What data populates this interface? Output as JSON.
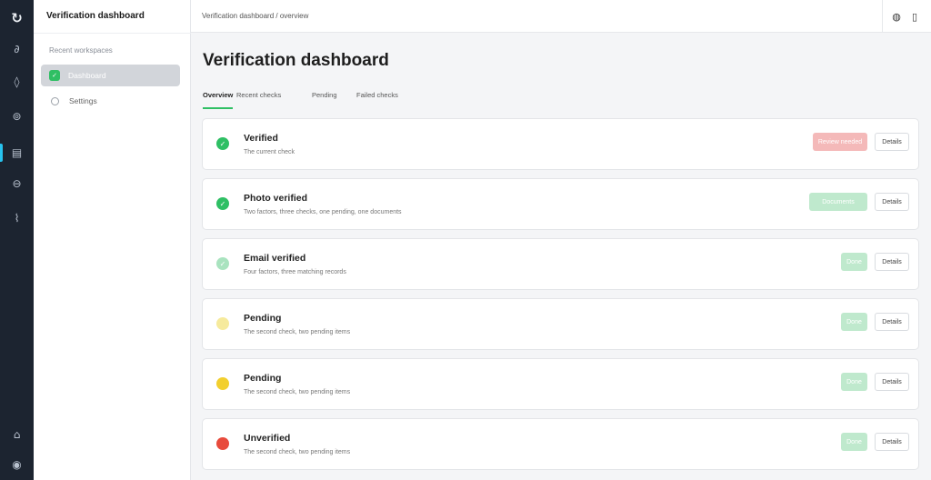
{
  "rail": {
    "logo": "↻",
    "icons": [
      "∂",
      "◊",
      "⊚",
      "▤",
      "⊖",
      "⌇"
    ],
    "bottom_icons": [
      "⌂",
      "◉"
    ],
    "accent_color": "#27c3ef"
  },
  "sidebar": {
    "title": "Verification dashboard",
    "section_label": "Recent workspaces",
    "items": [
      {
        "label": "Dashboard",
        "icon": "check-square-icon",
        "active": true
      },
      {
        "label": "Settings",
        "icon": "ring-icon",
        "active": false
      }
    ]
  },
  "header": {
    "breadcrumb": "Verification dashboard / overview",
    "right_icons": [
      "globe-icon",
      "page-icon"
    ]
  },
  "main": {
    "title": "Verification dashboard",
    "tabs": [
      {
        "label": "Overview",
        "active": true
      },
      {
        "label": "Recent checks",
        "active": false
      },
      {
        "label": "Pending",
        "active": false
      },
      {
        "label": "Failed checks",
        "active": false
      }
    ],
    "cards": [
      {
        "title": "Verified",
        "subtitle": "The current check",
        "status": "verified",
        "dot_color": "#2fbf64",
        "dot_glyph": "✓",
        "badge": "Review needed",
        "badge_bg": "#f4b9b9",
        "badge_fg": "#ffffff",
        "button": "Details"
      },
      {
        "title": "Photo verified",
        "subtitle": "Two factors, three checks, one pending, one documents",
        "status": "verified",
        "dot_color": "#2fbf64",
        "dot_glyph": "✓",
        "badge": "Documents",
        "badge_bg": "#bfe9cd",
        "badge_fg": "#ffffff",
        "button": "Details"
      },
      {
        "title": "Email verified",
        "subtitle": "Four factors, three matching records",
        "status": "partial",
        "dot_color": "#a9e3bf",
        "dot_glyph": "✓",
        "badge": "Done",
        "badge_bg": "#bfe9cd",
        "badge_fg": "#ffffff",
        "button": "Details"
      },
      {
        "title": "Pending",
        "subtitle": "The second check, two pending items",
        "status": "pending",
        "dot_color": "#f6ea9c",
        "dot_glyph": "",
        "badge": "Done",
        "badge_bg": "#bfe9cd",
        "badge_fg": "#ffffff",
        "button": "Details"
      },
      {
        "title": "Pending",
        "subtitle": "The second check, two pending items",
        "status": "pending",
        "dot_color": "#f2cf2e",
        "dot_glyph": "",
        "badge": "Done",
        "badge_bg": "#bfe9cd",
        "badge_fg": "#ffffff",
        "button": "Details"
      },
      {
        "title": "Unverified",
        "subtitle": "The second check, two pending items",
        "status": "failed",
        "dot_color": "#e84b3c",
        "dot_glyph": "",
        "badge": "Done",
        "badge_bg": "#bfe9cd",
        "badge_fg": "#ffffff",
        "button": "Details"
      }
    ]
  }
}
